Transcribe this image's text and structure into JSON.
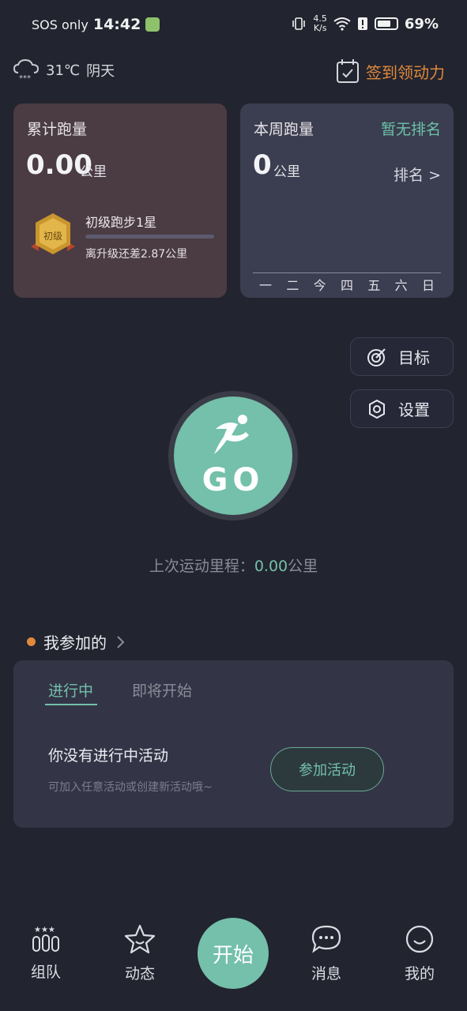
{
  "status_bar": {
    "carrier": "SOS only",
    "time": "14:42",
    "net_speed_value": "4.5",
    "net_speed_unit": "K/s",
    "battery": "69%"
  },
  "weather": {
    "temperature": "31℃",
    "condition": "阴天"
  },
  "checkin": {
    "label": "签到领动力"
  },
  "total_card": {
    "title": "累计跑量",
    "distance": "0.00",
    "unit": "公里",
    "level_name": "初级跑步1星",
    "badge_text": "初级",
    "level_progress": 0,
    "remain_text": "离升级还差2.87公里"
  },
  "week_card": {
    "title": "本周跑量",
    "distance": "0",
    "unit": "公里",
    "rank_status": "暂无排名",
    "rank_link": "排名 >",
    "days": [
      "一",
      "二",
      "今",
      "四",
      "五",
      "六",
      "日"
    ]
  },
  "actions": {
    "target_label": "目标",
    "settings_label": "设置"
  },
  "go_button": {
    "label": "GO"
  },
  "last_run": {
    "label": "上次运动里程：",
    "value": "0.00",
    "unit": "公里"
  },
  "joined": {
    "title": "我参加的",
    "tabs": [
      {
        "label": "进行中",
        "active": true
      },
      {
        "label": "即将开始",
        "active": false
      }
    ],
    "empty_title": "你没有进行中活动",
    "empty_sub": "可加入任意活动或创建新活动哦~",
    "join_button": "参加活动"
  },
  "bottom_nav": {
    "items": [
      {
        "label": "组队",
        "icon": "team-icon"
      },
      {
        "label": "动态",
        "icon": "star-icon"
      },
      {
        "label": "消息",
        "icon": "message-icon"
      },
      {
        "label": "我的",
        "icon": "profile-icon"
      }
    ],
    "start_label": "开始"
  },
  "colors": {
    "accent": "#74c0aa",
    "orange": "#e0893c",
    "background": "#22242f"
  }
}
